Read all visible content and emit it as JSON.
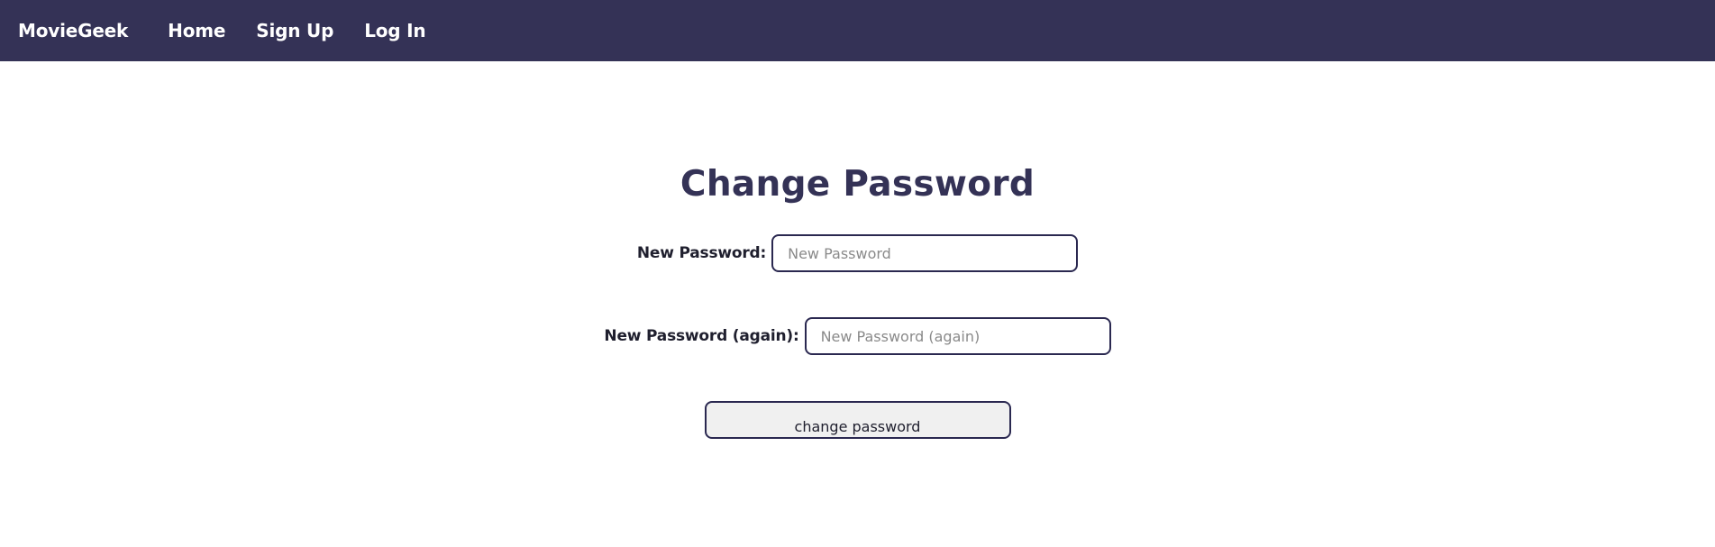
{
  "nav": {
    "brand": "MovieGeek",
    "links": [
      {
        "label": "Home"
      },
      {
        "label": "Sign Up"
      },
      {
        "label": "Log In"
      }
    ]
  },
  "page": {
    "title": "Change Password"
  },
  "form": {
    "new_password": {
      "label": "New Password:",
      "placeholder": "New Password",
      "value": ""
    },
    "new_password_again": {
      "label": "New Password (again):",
      "placeholder": "New Password (again)",
      "value": ""
    },
    "submit_label": "change password"
  },
  "colors": {
    "navbar_bg": "#343256",
    "title": "#343256",
    "input_border": "#2a2850",
    "button_bg": "#f0f0f0"
  }
}
